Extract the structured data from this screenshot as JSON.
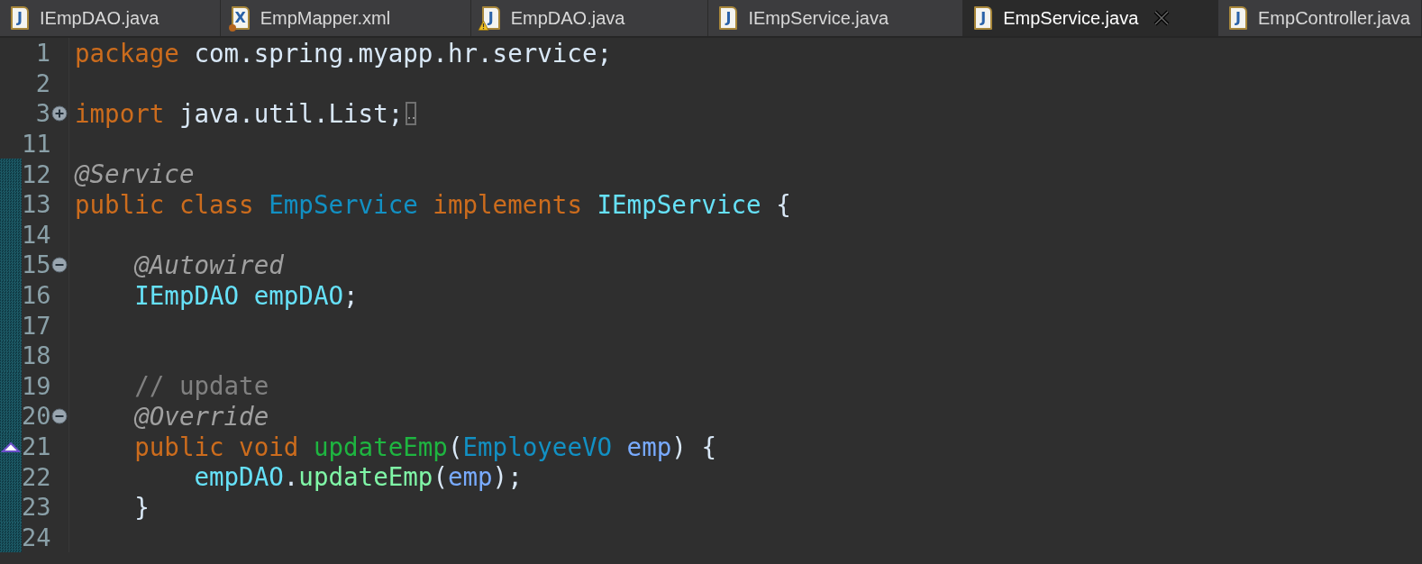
{
  "tabs": [
    {
      "label": "IEmpDAO.java",
      "kind": "java-file",
      "icon_letter": "J",
      "warning": false,
      "selected": false
    },
    {
      "label": "EmpMapper.xml",
      "kind": "xml-file",
      "icon_letter": "X",
      "warning": false,
      "selected": false
    },
    {
      "label": "EmpDAO.java",
      "kind": "java-file",
      "icon_letter": "J",
      "warning": true,
      "selected": false
    },
    {
      "label": "IEmpService.java",
      "kind": "java-file",
      "icon_letter": "J",
      "warning": false,
      "selected": false
    },
    {
      "label": "EmpService.java",
      "kind": "java-file",
      "icon_letter": "J",
      "warning": false,
      "selected": true
    },
    {
      "label": "EmpController.java",
      "kind": "java-file",
      "icon_letter": "J",
      "warning": false,
      "selected": false
    }
  ],
  "editor": {
    "lines": [
      {
        "number": "1",
        "changed": false,
        "override_marker": false,
        "folded": false,
        "tokens": [
          {
            "text": "package",
            "kind": "keyword"
          },
          {
            "text": " com.spring.myapp.hr.service;",
            "kind": "plain"
          }
        ]
      },
      {
        "number": "2",
        "changed": false,
        "override_marker": false,
        "folded": false
      },
      {
        "number": "3",
        "expanded": false,
        "changed": false,
        "override_marker": false,
        "folded": true,
        "tokens": [
          {
            "text": "import",
            "kind": "keyword"
          },
          {
            "text": " java.util.List;",
            "kind": "plain"
          }
        ]
      },
      {
        "number": "11",
        "changed": false,
        "override_marker": false,
        "folded": false
      },
      {
        "number": "12",
        "changed": true,
        "override_marker": false,
        "folded": false,
        "tokens": [
          {
            "text": "@Service",
            "kind": "annotation"
          }
        ]
      },
      {
        "number": "13",
        "changed": true,
        "override_marker": false,
        "folded": false,
        "tokens": [
          {
            "text": "public class ",
            "kind": "keyword"
          },
          {
            "text": "EmpService",
            "kind": "class"
          },
          {
            "text": " implements ",
            "kind": "keyword"
          },
          {
            "text": "IEmpService",
            "kind": "interface"
          },
          {
            "text": " {",
            "kind": "plain"
          }
        ]
      },
      {
        "number": "14",
        "changed": true,
        "override_marker": false,
        "folded": false
      },
      {
        "number": "15",
        "expanded": true,
        "changed": true,
        "override_marker": false,
        "folded": false,
        "tokens": [
          {
            "text": "    @Autowired",
            "kind": "annotation"
          }
        ]
      },
      {
        "number": "16",
        "changed": true,
        "override_marker": false,
        "folded": false,
        "tokens": [
          {
            "text": "    IEmpDAO empDAO",
            "kind": "interface"
          },
          {
            "text": ";",
            "kind": "plain"
          }
        ]
      },
      {
        "number": "17",
        "changed": true,
        "override_marker": false,
        "folded": false
      },
      {
        "number": "18",
        "changed": true,
        "override_marker": false,
        "folded": false
      },
      {
        "number": "19",
        "changed": true,
        "override_marker": false,
        "folded": false,
        "tokens": [
          {
            "text": "    // update",
            "kind": "comment"
          }
        ]
      },
      {
        "number": "20",
        "expanded": true,
        "changed": true,
        "override_marker": false,
        "folded": false,
        "tokens": [
          {
            "text": "    @Override",
            "kind": "annotation"
          }
        ]
      },
      {
        "number": "21",
        "changed": true,
        "override_marker": true,
        "folded": false,
        "tokens": [
          {
            "text": "    public void ",
            "kind": "keyword"
          },
          {
            "text": "updateEmp",
            "kind": "method-decl"
          },
          {
            "text": "(",
            "kind": "plain"
          },
          {
            "text": "EmployeeVO ",
            "kind": "class"
          },
          {
            "text": "emp",
            "kind": "param"
          },
          {
            "text": ") {",
            "kind": "plain"
          }
        ]
      },
      {
        "number": "22",
        "changed": true,
        "override_marker": false,
        "folded": false,
        "tokens": [
          {
            "text": "        empDAO",
            "kind": "interface"
          },
          {
            "text": ".",
            "kind": "plain"
          },
          {
            "text": "updateEmp",
            "kind": "method-call"
          },
          {
            "text": "(",
            "kind": "plain"
          },
          {
            "text": "emp",
            "kind": "param"
          },
          {
            "text": ");",
            "kind": "plain"
          }
        ]
      },
      {
        "number": "23",
        "changed": true,
        "override_marker": false,
        "folded": false,
        "tokens": [
          {
            "text": "    }",
            "kind": "plain"
          }
        ]
      },
      {
        "number": "24",
        "changed": true,
        "override_marker": false,
        "folded": false
      }
    ]
  }
}
